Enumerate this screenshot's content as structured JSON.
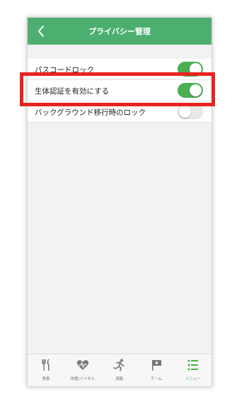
{
  "colors": {
    "accent": "#4caf70",
    "highlight": "#e8231f"
  },
  "header": {
    "title": "プライバシー管理",
    "back_icon": "chevron-left-icon"
  },
  "settings": [
    {
      "label": "パスコードロック",
      "on": true
    },
    {
      "label": "生体認証を有効にする",
      "on": true
    },
    {
      "label": "バックグラウンド移行時のロック",
      "on": false
    }
  ],
  "tabs": [
    {
      "label": "食事",
      "icon": "fork-knife-icon",
      "active": false
    },
    {
      "label": "体重/バイタル",
      "icon": "heart-vital-icon",
      "active": false
    },
    {
      "label": "運動",
      "icon": "running-icon",
      "active": false
    },
    {
      "label": "チーム",
      "icon": "flag-icon",
      "active": false
    },
    {
      "label": "メニュー",
      "icon": "menu-list-icon",
      "active": true
    }
  ]
}
